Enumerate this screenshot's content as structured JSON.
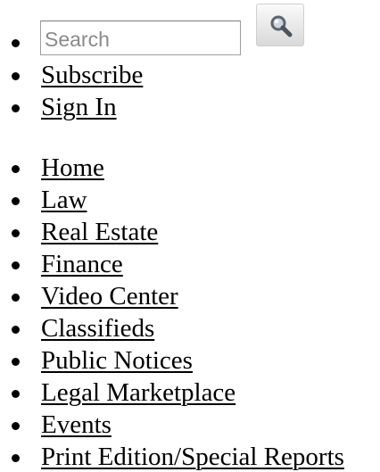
{
  "search": {
    "placeholder": "Search",
    "button_icon": "search-icon"
  },
  "account_links": [
    {
      "label": "Subscribe"
    },
    {
      "label": "Sign In"
    }
  ],
  "nav": {
    "items": [
      {
        "label": "Home"
      },
      {
        "label": "Law"
      },
      {
        "label": "Real Estate"
      },
      {
        "label": "Finance"
      },
      {
        "label": "Video Center"
      },
      {
        "label": "Classifieds"
      },
      {
        "label": "Public Notices"
      },
      {
        "label": "Legal Marketplace"
      },
      {
        "label": "Events"
      },
      {
        "label": "Print Edition/Special Reports"
      }
    ]
  },
  "colors": {
    "text": "#000000",
    "input_border": "#9e9e9e",
    "button_face": "#e6e6e6"
  }
}
